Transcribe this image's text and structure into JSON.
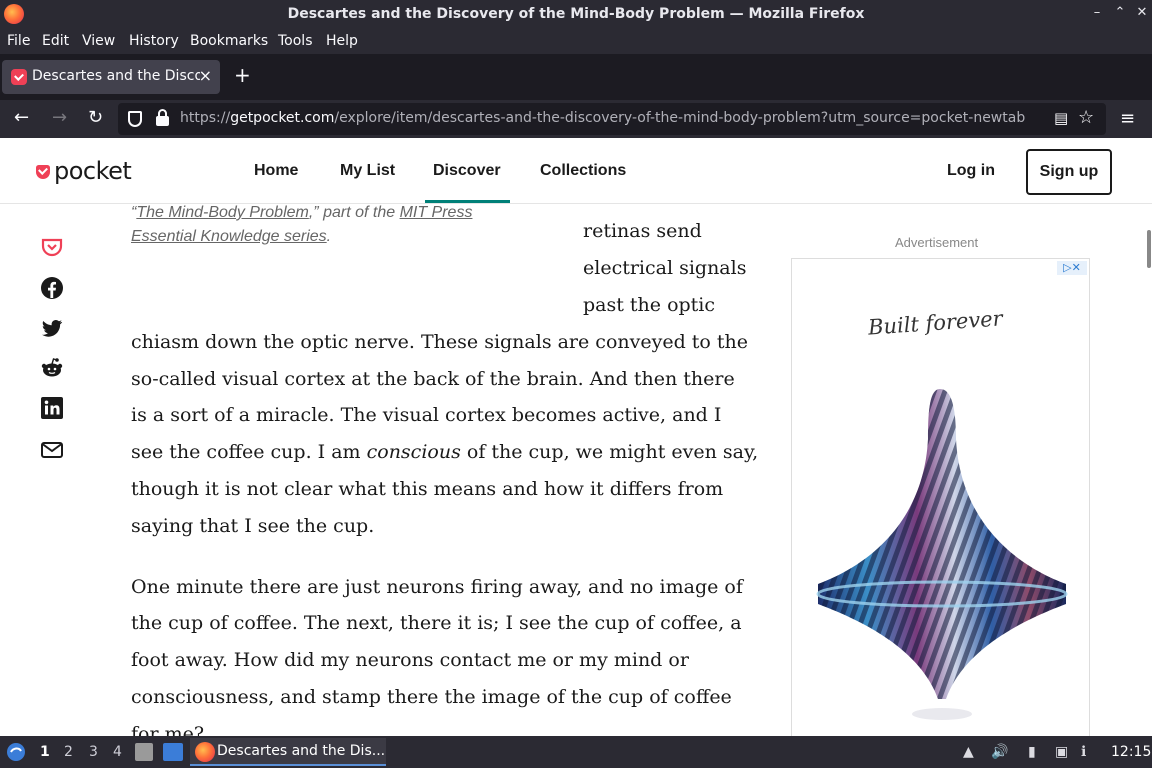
{
  "window": {
    "title": "Descartes and the Discovery of the Mind-Body Problem — Mozilla Firefox",
    "controls": [
      "–",
      "⌃",
      "✕"
    ]
  },
  "menubar": [
    "File",
    "Edit",
    "View",
    "History",
    "Bookmarks",
    "Tools",
    "Help"
  ],
  "tab": {
    "label": "Descartes and the Discovery of the Mind-Body Problem",
    "new_tab": "+",
    "close": "×"
  },
  "urlbar": {
    "url_prefix": "https://",
    "url_host": "getpocket.com",
    "url_path": "/explore/item/descartes-and-the-discovery-of-the-mind-body-problem?utm_source=pocket-newtab"
  },
  "site": {
    "logo": "pocket",
    "nav": [
      "Home",
      "My List",
      "Discover",
      "Collections"
    ],
    "active_nav": "Discover",
    "login": "Log in",
    "signup": "Sign up"
  },
  "share_icons": [
    "pocket-save-icon",
    "facebook-icon",
    "twitter-icon",
    "reddit-icon",
    "linkedin-icon",
    "email-icon"
  ],
  "caption": {
    "open_quote": "“",
    "link1": "The Mind-Body Problem",
    "mid": ",” part of the ",
    "link2": "MIT Press Essential Knowledge series",
    "end": "."
  },
  "article": {
    "narrow_lines": [
      "retinas send",
      "electrical signals",
      "past the optic"
    ],
    "paragraph1_lines": [
      "chiasm down the optic nerve. These signals are conveyed to the",
      "so-called visual cortex at the back of the brain. And then there",
      "is a sort of a miracle. The visual cortex becomes active, and I",
      "see the coffee cup. I am",
      "conscious",
      "of the cup, we might even say,",
      "though it is not clear what this means and how it differs from",
      "saying that I see the cup."
    ],
    "paragraph2_lines": [
      "One minute there are just neurons firing away, and no image of",
      "the cup of coffee. The next, there it is; I see the cup of coffee, a",
      "foot away. How did my neurons contact me or my mind or",
      "consciousness, and stamp there the image of the cup of coffee",
      "for me?"
    ]
  },
  "ad": {
    "label": "Advertisement",
    "script": "Built forever",
    "adchoices": "▷✕"
  },
  "taskbar": {
    "workspaces": [
      "1",
      "2",
      "3",
      "4"
    ],
    "active_workspace": "1",
    "window_label": "Descartes and the Dis...",
    "clock": "12:15"
  }
}
